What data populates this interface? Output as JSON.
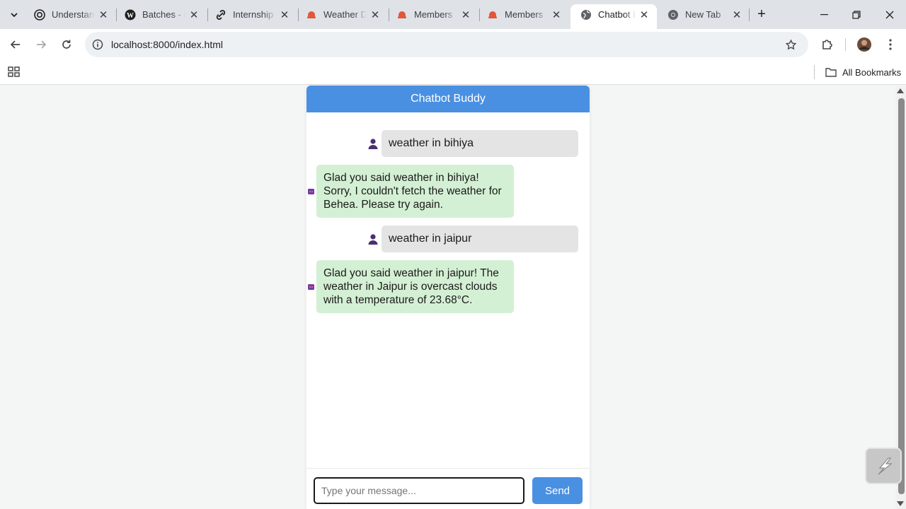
{
  "browser": {
    "tabs": [
      {
        "title": "Understanding",
        "icon": "openai-icon"
      },
      {
        "title": "Batches - Fo",
        "icon": "wordpress-icon"
      },
      {
        "title": "Internship",
        "icon": "link-icon"
      },
      {
        "title": "Weather Da",
        "icon": "cloud-icon"
      },
      {
        "title": "Members",
        "icon": "cloud-icon"
      },
      {
        "title": "Members",
        "icon": "cloud-icon"
      },
      {
        "title": "Chatbot Bu",
        "icon": "globe-icon",
        "active": true
      },
      {
        "title": "New Tab",
        "icon": "chrome-icon"
      }
    ],
    "url": "localhost:8000/index.html",
    "bookmarks_label": "All Bookmarks",
    "colors": {
      "tab_strip": "#dfe3e8",
      "omnibox": "#eef1f4",
      "tab_orange": "#e2563b"
    }
  },
  "chat": {
    "header_title": "Chatbot Buddy",
    "messages": [
      {
        "sender": "user",
        "text": "weather in bihiya"
      },
      {
        "sender": "bot",
        "text": "Glad you said weather in bihiya! Sorry, I couldn't fetch the weather for Behea. Please try again."
      },
      {
        "sender": "user",
        "text": "weather in jaipur"
      },
      {
        "sender": "bot",
        "text": "Glad you said weather in jaipur! The weather in Jaipur is overcast clouds with a temperature of 23.68°C."
      }
    ],
    "input": {
      "value": "",
      "placeholder": "Type your message..."
    },
    "send_label": "Send",
    "colors": {
      "header": "#4a90e2",
      "user_bubble": "#e4e4e4",
      "bot_bubble": "#d4f0d4",
      "send_button": "#4a90e2"
    }
  }
}
